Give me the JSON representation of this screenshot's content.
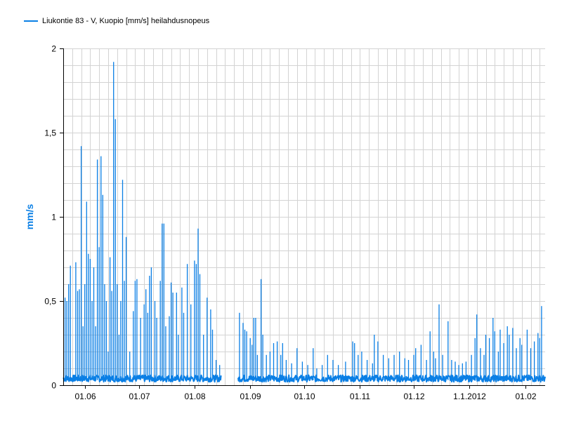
{
  "colors": {
    "series": "#0a7fe5",
    "grid": "#d3d3d3",
    "axis": "#000000"
  },
  "chart_data": {
    "type": "line",
    "title": "",
    "xlabel": "",
    "ylabel": "mm/s",
    "ylim": [
      0,
      2
    ],
    "y_ticks": [
      0,
      0.5,
      1,
      1.5,
      2
    ],
    "y_tick_labels": [
      "0",
      "0,5",
      "1",
      "1,5",
      "2"
    ],
    "x_tick_labels": [
      "01.06",
      "01.07",
      "01.08",
      "01.09",
      "01.10",
      "01.11",
      "01.12",
      "1.1.2012",
      "01.02"
    ],
    "x_tick_dates": [
      "2011-06-01",
      "2011-07-01",
      "2011-08-01",
      "2011-09-01",
      "2011-10-01",
      "2011-11-01",
      "2011-12-01",
      "2012-01-01",
      "2012-02-01"
    ],
    "xlim": [
      "2011-05-20",
      "2012-02-12"
    ],
    "grid": true,
    "legend": "top-left",
    "series": [
      {
        "name": "Liukontie 83 - V, Kuopio [mm/s] heilahdusnopeus",
        "color": "#0a7fe5",
        "gap": [
          "2011-08-16",
          "2011-08-25"
        ],
        "baseline_range": [
          0.02,
          0.06
        ],
        "peaks": [
          [
            "2011-05-21",
            0.52
          ],
          [
            "2011-05-22",
            0.5
          ],
          [
            "2011-05-23",
            0.6
          ],
          [
            "2011-05-24",
            0.71
          ],
          [
            "2011-05-27",
            0.73
          ],
          [
            "2011-05-28",
            0.56
          ],
          [
            "2011-05-29",
            0.57
          ],
          [
            "2011-05-30",
            1.42
          ],
          [
            "2011-05-31",
            0.35
          ],
          [
            "2011-06-01",
            0.6
          ],
          [
            "2011-06-02",
            1.09
          ],
          [
            "2011-06-03",
            0.78
          ],
          [
            "2011-06-04",
            0.75
          ],
          [
            "2011-06-05",
            0.5
          ],
          [
            "2011-06-06",
            0.7
          ],
          [
            "2011-06-07",
            0.35
          ],
          [
            "2011-06-08",
            1.34
          ],
          [
            "2011-06-09",
            0.82
          ],
          [
            "2011-06-10",
            1.36
          ],
          [
            "2011-06-11",
            1.13
          ],
          [
            "2011-06-12",
            0.6
          ],
          [
            "2011-06-13",
            0.5
          ],
          [
            "2011-06-14",
            0.2
          ],
          [
            "2011-06-15",
            0.76
          ],
          [
            "2011-06-16",
            0.56
          ],
          [
            "2011-06-17",
            1.92
          ],
          [
            "2011-06-18",
            1.58
          ],
          [
            "2011-06-19",
            0.6
          ],
          [
            "2011-06-20",
            0.3
          ],
          [
            "2011-06-21",
            0.5
          ],
          [
            "2011-06-22",
            1.22
          ],
          [
            "2011-06-23",
            0.62
          ],
          [
            "2011-06-24",
            0.88
          ],
          [
            "2011-06-26",
            0.2
          ],
          [
            "2011-06-28",
            0.44
          ],
          [
            "2011-06-29",
            0.62
          ],
          [
            "2011-06-30",
            0.63
          ],
          [
            "2011-07-02",
            0.4
          ],
          [
            "2011-07-04",
            0.48
          ],
          [
            "2011-07-05",
            0.57
          ],
          [
            "2011-07-06",
            0.43
          ],
          [
            "2011-07-07",
            0.65
          ],
          [
            "2011-07-08",
            0.7
          ],
          [
            "2011-07-10",
            0.5
          ],
          [
            "2011-07-11",
            0.4
          ],
          [
            "2011-07-13",
            0.62
          ],
          [
            "2011-07-14",
            0.96
          ],
          [
            "2011-07-15",
            0.96
          ],
          [
            "2011-07-16",
            0.35
          ],
          [
            "2011-07-18",
            0.41
          ],
          [
            "2011-07-19",
            0.61
          ],
          [
            "2011-07-20",
            0.55
          ],
          [
            "2011-07-22",
            0.55
          ],
          [
            "2011-07-23",
            0.3
          ],
          [
            "2011-07-25",
            0.58
          ],
          [
            "2011-07-26",
            0.43
          ],
          [
            "2011-07-28",
            0.72
          ],
          [
            "2011-07-30",
            0.48
          ],
          [
            "2011-08-01",
            0.74
          ],
          [
            "2011-08-02",
            0.72
          ],
          [
            "2011-08-03",
            0.93
          ],
          [
            "2011-08-04",
            0.66
          ],
          [
            "2011-08-06",
            0.3
          ],
          [
            "2011-08-08",
            0.52
          ],
          [
            "2011-08-10",
            0.45
          ],
          [
            "2011-08-11",
            0.33
          ],
          [
            "2011-08-13",
            0.15
          ],
          [
            "2011-08-15",
            0.12
          ],
          [
            "2011-08-26",
            0.43
          ],
          [
            "2011-08-28",
            0.37
          ],
          [
            "2011-08-29",
            0.33
          ],
          [
            "2011-08-30",
            0.32
          ],
          [
            "2011-09-01",
            0.28
          ],
          [
            "2011-09-02",
            0.24
          ],
          [
            "2011-09-03",
            0.4
          ],
          [
            "2011-09-04",
            0.4
          ],
          [
            "2011-09-05",
            0.18
          ],
          [
            "2011-09-07",
            0.63
          ],
          [
            "2011-09-08",
            0.3
          ],
          [
            "2011-09-10",
            0.18
          ],
          [
            "2011-09-12",
            0.2
          ],
          [
            "2011-09-14",
            0.25
          ],
          [
            "2011-09-16",
            0.26
          ],
          [
            "2011-09-18",
            0.18
          ],
          [
            "2011-09-19",
            0.25
          ],
          [
            "2011-09-21",
            0.15
          ],
          [
            "2011-09-24",
            0.13
          ],
          [
            "2011-09-27",
            0.22
          ],
          [
            "2011-09-30",
            0.14
          ],
          [
            "2011-10-03",
            0.12
          ],
          [
            "2011-10-06",
            0.22
          ],
          [
            "2011-10-08",
            0.1
          ],
          [
            "2011-10-11",
            0.12
          ],
          [
            "2011-10-14",
            0.18
          ],
          [
            "2011-10-17",
            0.15
          ],
          [
            "2011-10-20",
            0.12
          ],
          [
            "2011-10-24",
            0.14
          ],
          [
            "2011-10-28",
            0.26
          ],
          [
            "2011-10-29",
            0.25
          ],
          [
            "2011-10-31",
            0.18
          ],
          [
            "2011-11-02",
            0.2
          ],
          [
            "2011-11-05",
            0.15
          ],
          [
            "2011-11-08",
            0.13
          ],
          [
            "2011-11-09",
            0.3
          ],
          [
            "2011-11-11",
            0.26
          ],
          [
            "2011-11-14",
            0.18
          ],
          [
            "2011-11-17",
            0.16
          ],
          [
            "2011-11-20",
            0.18
          ],
          [
            "2011-11-23",
            0.2
          ],
          [
            "2011-11-26",
            0.16
          ],
          [
            "2011-11-28",
            0.15
          ],
          [
            "2011-12-01",
            0.18
          ],
          [
            "2011-12-02",
            0.22
          ],
          [
            "2011-12-05",
            0.24
          ],
          [
            "2011-12-08",
            0.15
          ],
          [
            "2011-12-10",
            0.32
          ],
          [
            "2011-12-12",
            0.2
          ],
          [
            "2011-12-13",
            0.16
          ],
          [
            "2011-12-15",
            0.48
          ],
          [
            "2011-12-17",
            0.18
          ],
          [
            "2011-12-20",
            0.38
          ],
          [
            "2011-12-22",
            0.15
          ],
          [
            "2011-12-24",
            0.14
          ],
          [
            "2011-12-26",
            0.12
          ],
          [
            "2011-12-28",
            0.13
          ],
          [
            "2011-12-30",
            0.14
          ],
          [
            "2012-01-02",
            0.18
          ],
          [
            "2012-01-04",
            0.28
          ],
          [
            "2012-01-05",
            0.42
          ],
          [
            "2012-01-07",
            0.22
          ],
          [
            "2012-01-09",
            0.18
          ],
          [
            "2012-01-10",
            0.3
          ],
          [
            "2012-01-12",
            0.28
          ],
          [
            "2012-01-14",
            0.4
          ],
          [
            "2012-01-15",
            0.32
          ],
          [
            "2012-01-17",
            0.2
          ],
          [
            "2012-01-18",
            0.33
          ],
          [
            "2012-01-20",
            0.25
          ],
          [
            "2012-01-22",
            0.35
          ],
          [
            "2012-01-23",
            0.3
          ],
          [
            "2012-01-25",
            0.34
          ],
          [
            "2012-01-27",
            0.22
          ],
          [
            "2012-01-29",
            0.28
          ],
          [
            "2012-01-30",
            0.24
          ],
          [
            "2012-02-02",
            0.33
          ],
          [
            "2012-02-04",
            0.22
          ],
          [
            "2012-02-06",
            0.26
          ],
          [
            "2012-02-08",
            0.31
          ],
          [
            "2012-02-09",
            0.28
          ],
          [
            "2012-02-10",
            0.47
          ]
        ]
      }
    ]
  }
}
